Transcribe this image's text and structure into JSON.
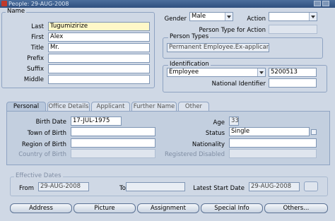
{
  "window": {
    "title": "People: 29-AUG-2008"
  },
  "name_group": {
    "title": "Name",
    "last_label": "Last",
    "last_value": "Tugumizirize",
    "first_label": "First",
    "first_value": "Alex",
    "title_label": "Title",
    "title_value": "Mr.",
    "prefix_label": "Prefix",
    "prefix_value": "",
    "suffix_label": "Suffix",
    "suffix_value": "",
    "middle_label": "Middle",
    "middle_value": ""
  },
  "gender": {
    "label": "Gender",
    "value": "Male"
  },
  "action": {
    "label": "Action",
    "value": ""
  },
  "person_type_for_action": {
    "label": "Person Type for Action",
    "value": ""
  },
  "person_types": {
    "title": "Person Types",
    "value": "Permanent Employee.Ex-applicant"
  },
  "identification": {
    "title": "Identification",
    "type_value": "Employee",
    "number_value": "5200513",
    "ni_label": "National Identifier",
    "ni_value": ""
  },
  "tabs": [
    {
      "label": "Personal"
    },
    {
      "label": "Office Details"
    },
    {
      "label": "Applicant"
    },
    {
      "label": "Further Name"
    },
    {
      "label": "Other"
    }
  ],
  "personal": {
    "birth_date_label": "Birth Date",
    "birth_date_value": "17-JUL-1975",
    "town_label": "Town of Birth",
    "town_value": "",
    "region_label": "Region of Birth",
    "region_value": "",
    "country_label": "Country of Birth",
    "country_value": "",
    "age_label": "Age",
    "age_value": "33",
    "status_label": "Status",
    "status_value": "Single",
    "nationality_label": "Nationality",
    "nationality_value": "",
    "reg_disabled_label": "Registered Disabled",
    "reg_disabled_value": ""
  },
  "effective_dates": {
    "title": "Effective Dates",
    "from_label": "From",
    "from_value": "29-AUG-2008",
    "to_label": "To",
    "to_value": "",
    "latest_label": "Latest Start Date",
    "latest_value": "29-AUG-2008"
  },
  "buttons": {
    "address": "Address",
    "picture": "Picture",
    "assignment": "Assignment",
    "special_info": "Special Info",
    "others": "Others..."
  },
  "colors": {
    "background": "#cfd8e5",
    "titlebar": "#2e4f7f",
    "highlight_field": "#fff8c8"
  }
}
